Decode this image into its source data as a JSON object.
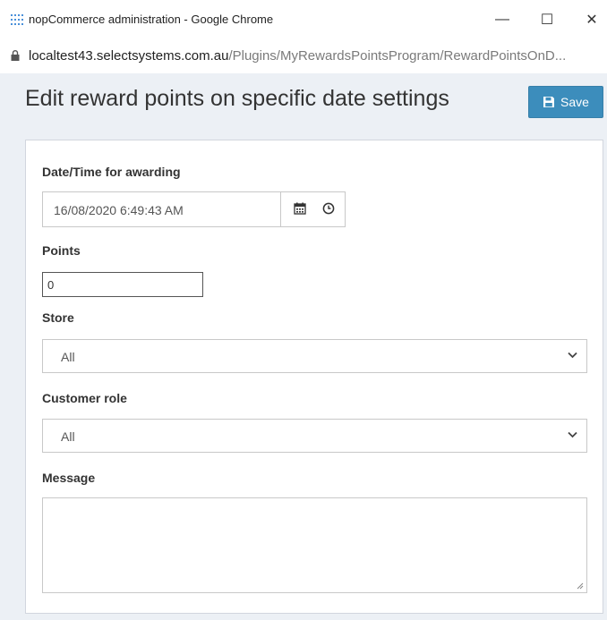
{
  "window": {
    "title": "nopCommerce administration - Google Chrome",
    "minimize_glyph": "—",
    "maximize_glyph": "☐",
    "close_glyph": "✕"
  },
  "address": {
    "host": "localtest43.selectsystems.com.au",
    "path": "/Plugins/MyRewardsPointsProgram/RewardPointsOnD..."
  },
  "page": {
    "title": "Edit reward points on specific date settings",
    "save_label": "Save"
  },
  "form": {
    "datetime": {
      "label": "Date/Time for awarding",
      "value": "16/08/2020 6:49:43 AM"
    },
    "points": {
      "label": "Points",
      "value": "0"
    },
    "store": {
      "label": "Store",
      "value": "All"
    },
    "customer_role": {
      "label": "Customer role",
      "value": "All"
    },
    "message": {
      "label": "Message",
      "value": ""
    }
  },
  "colors": {
    "accent": "#3c8dbc",
    "background": "#ecf0f5"
  },
  "icons": [
    "app-grid-icon",
    "lock-icon",
    "save-floppy-icon",
    "calendar-icon",
    "clock-icon",
    "chevron-down-icon",
    "resize-handle-icon"
  ]
}
